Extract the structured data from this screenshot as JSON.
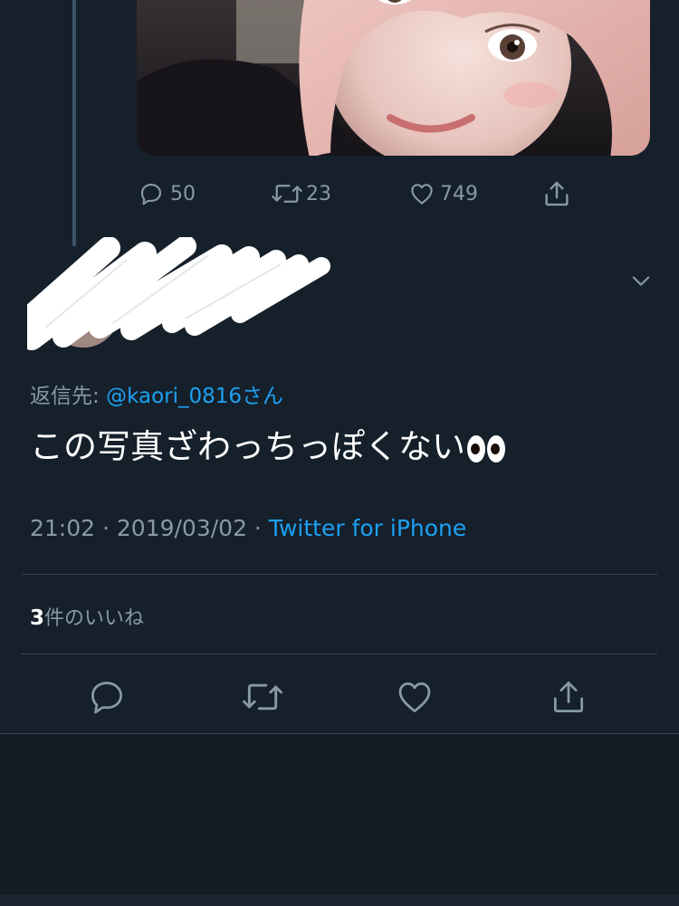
{
  "previous_tweet": {
    "reply_count": "50",
    "retweet_count": "23",
    "like_count": "749"
  },
  "tweet": {
    "reply_prefix": "返信先: ",
    "reply_handle": "@kaori_0816さん",
    "text": "この写真ざわっちっぽくない",
    "time": "21:02",
    "separator": " · ",
    "date": "2019/03/02",
    "client": "Twitter for iPhone",
    "likes_count": "3",
    "likes_label": "件のいいね"
  },
  "colors": {
    "background": "#15202b",
    "accent": "#1da1f2",
    "secondary_text": "#8899a6",
    "divider": "#38444d"
  },
  "icons": {
    "reply": "reply-icon",
    "retweet": "retweet-icon",
    "like": "heart-icon",
    "share": "share-icon",
    "more": "chevron-down-icon",
    "emoji": "eyes-emoji"
  }
}
